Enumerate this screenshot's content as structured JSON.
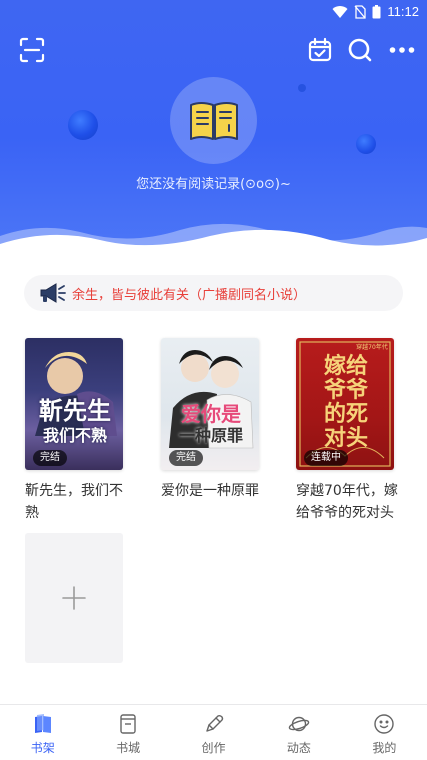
{
  "status_bar": {
    "time": "11:12"
  },
  "header": {
    "empty_message": "您还没有阅读记录(⊙o⊙)~"
  },
  "notice": {
    "text": "余生，皆与彼此有关（广播剧同名小说）"
  },
  "books": [
    {
      "title": "靳先生，我们不熟",
      "badge": "完结",
      "cover_text": [
        "靳先生",
        "我们不熟"
      ]
    },
    {
      "title": "爱你是一种原罪",
      "badge": "完结",
      "cover_text": [
        "爱你是",
        "一种原罪"
      ]
    },
    {
      "title": "穿越70年代，嫁给爷爷的死对头",
      "badge": "连载中",
      "cover_text": [
        "嫁给",
        "爷爷",
        "的死",
        "对头"
      ],
      "cover_subtext": "穿越70年代"
    }
  ],
  "nav": {
    "items": [
      {
        "label": "书架",
        "active": true
      },
      {
        "label": "书城",
        "active": false
      },
      {
        "label": "创作",
        "active": false
      },
      {
        "label": "动态",
        "active": false
      },
      {
        "label": "我的",
        "active": false
      }
    ]
  },
  "colors": {
    "accent": "#3a63f5",
    "notice_text": "#e8403a",
    "header_bg": "#3f66f2"
  },
  "icons": {
    "scan": "scan-icon",
    "calendar": "calendar-check-icon",
    "search": "search-icon",
    "more": "more-dots-icon",
    "notice": "megaphone-icon",
    "add": "plus-icon"
  }
}
